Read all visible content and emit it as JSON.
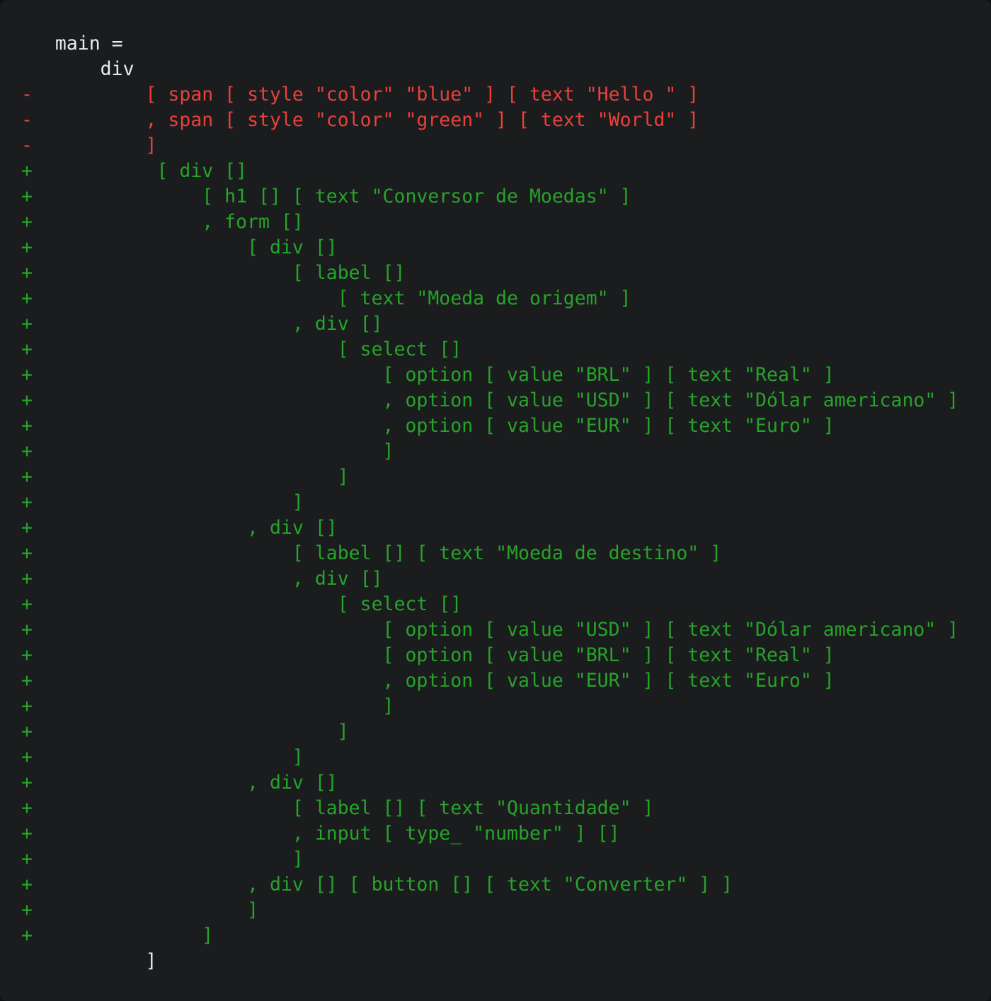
{
  "editor": {
    "kind": "code-diff",
    "language": "elm",
    "background_color": "#1a1c1e",
    "context_color": "#e8eaec",
    "deletion_color": "#e8413c",
    "addition_color": "#27a32a",
    "deletion_marker": "-",
    "addition_marker": "+",
    "context_marker": " "
  },
  "diff": {
    "lines": [
      {
        "marker": " ",
        "kind": "ctx",
        "text": "  main ="
      },
      {
        "marker": " ",
        "kind": "ctx",
        "text": "      div"
      },
      {
        "marker": "-",
        "kind": "del",
        "text": "          [ span [ style \"color\" \"blue\" ] [ text \"Hello \" ]"
      },
      {
        "marker": "-",
        "kind": "del",
        "text": "          , span [ style \"color\" \"green\" ] [ text \"World\" ]"
      },
      {
        "marker": "-",
        "kind": "del",
        "text": "          ]"
      },
      {
        "marker": "+",
        "kind": "add",
        "text": "           [ div []"
      },
      {
        "marker": "+",
        "kind": "add",
        "text": "               [ h1 [] [ text \"Conversor de Moedas\" ]"
      },
      {
        "marker": "+",
        "kind": "add",
        "text": "               , form []"
      },
      {
        "marker": "+",
        "kind": "add",
        "text": "                   [ div []"
      },
      {
        "marker": "+",
        "kind": "add",
        "text": "                       [ label []"
      },
      {
        "marker": "+",
        "kind": "add",
        "text": "                           [ text \"Moeda de origem\" ]"
      },
      {
        "marker": "+",
        "kind": "add",
        "text": "                       , div []"
      },
      {
        "marker": "+",
        "kind": "add",
        "text": "                           [ select []"
      },
      {
        "marker": "+",
        "kind": "add",
        "text": "                               [ option [ value \"BRL\" ] [ text \"Real\" ]"
      },
      {
        "marker": "+",
        "kind": "add",
        "text": "                               , option [ value \"USD\" ] [ text \"Dólar americano\" ]"
      },
      {
        "marker": "+",
        "kind": "add",
        "text": "                               , option [ value \"EUR\" ] [ text \"Euro\" ]"
      },
      {
        "marker": "+",
        "kind": "add",
        "text": "                               ]"
      },
      {
        "marker": "+",
        "kind": "add",
        "text": "                           ]"
      },
      {
        "marker": "+",
        "kind": "add",
        "text": "                       ]"
      },
      {
        "marker": "+",
        "kind": "add",
        "text": "                   , div []"
      },
      {
        "marker": "+",
        "kind": "add",
        "text": "                       [ label [] [ text \"Moeda de destino\" ]"
      },
      {
        "marker": "+",
        "kind": "add",
        "text": "                       , div []"
      },
      {
        "marker": "+",
        "kind": "add",
        "text": "                           [ select []"
      },
      {
        "marker": "+",
        "kind": "add",
        "text": "                               [ option [ value \"USD\" ] [ text \"Dólar americano\" ]"
      },
      {
        "marker": "+",
        "kind": "add",
        "text": "                               [ option [ value \"BRL\" ] [ text \"Real\" ]"
      },
      {
        "marker": "+",
        "kind": "add",
        "text": "                               , option [ value \"EUR\" ] [ text \"Euro\" ]"
      },
      {
        "marker": "+",
        "kind": "add",
        "text": "                               ]"
      },
      {
        "marker": "+",
        "kind": "add",
        "text": "                           ]"
      },
      {
        "marker": "+",
        "kind": "add",
        "text": "                       ]"
      },
      {
        "marker": "+",
        "kind": "add",
        "text": "                   , div []"
      },
      {
        "marker": "+",
        "kind": "add",
        "text": "                       [ label [] [ text \"Quantidade\" ]"
      },
      {
        "marker": "+",
        "kind": "add",
        "text": "                       , input [ type_ \"number\" ] []"
      },
      {
        "marker": "+",
        "kind": "add",
        "text": "                       ]"
      },
      {
        "marker": "+",
        "kind": "add",
        "text": "                   , div [] [ button [] [ text \"Converter\" ] ]"
      },
      {
        "marker": "+",
        "kind": "add",
        "text": "                   ]"
      },
      {
        "marker": "+",
        "kind": "add",
        "text": "               ]"
      },
      {
        "marker": " ",
        "kind": "ctx",
        "text": "          ]"
      }
    ]
  },
  "code_semantics": {
    "function_name": "main",
    "removed_markup": {
      "root": "div",
      "children": [
        {
          "tag": "span",
          "attributes": [
            {
              "name": "style",
              "args": [
                "color",
                "blue"
              ]
            }
          ],
          "text": "Hello "
        },
        {
          "tag": "span",
          "attributes": [
            {
              "name": "style",
              "args": [
                "color",
                "green"
              ]
            }
          ],
          "text": "World"
        }
      ]
    },
    "added_markup": {
      "root": "div",
      "heading": "Conversor de Moedas",
      "form_fields": [
        {
          "label": "Moeda de origem",
          "control": "select",
          "options": [
            {
              "value": "BRL",
              "text": "Real"
            },
            {
              "value": "USD",
              "text": "Dólar americano"
            },
            {
              "value": "EUR",
              "text": "Euro"
            }
          ]
        },
        {
          "label": "Moeda de destino",
          "control": "select",
          "options": [
            {
              "value": "USD",
              "text": "Dólar americano"
            },
            {
              "value": "BRL",
              "text": "Real"
            },
            {
              "value": "EUR",
              "text": "Euro"
            }
          ]
        },
        {
          "label": "Quantidade",
          "control": "input",
          "input_type": "number"
        }
      ],
      "submit_button": "Converter"
    }
  }
}
